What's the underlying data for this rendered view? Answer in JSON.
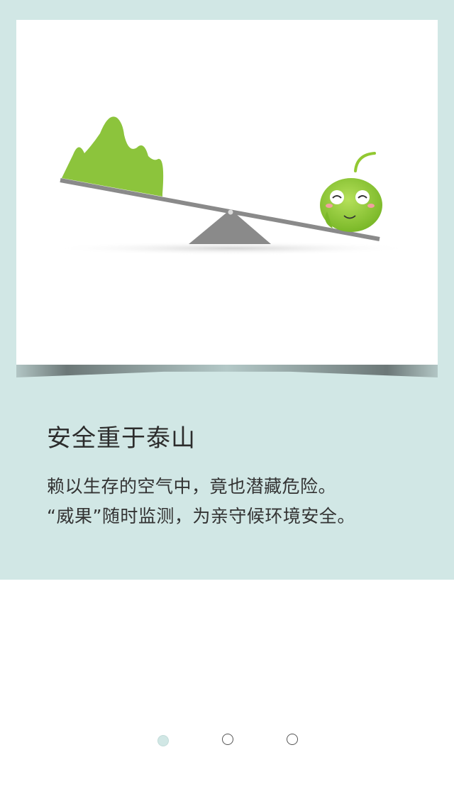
{
  "intro": {
    "headline": "安全重于泰山",
    "description_line1": "赖以生存的空气中，竟也潜藏危险。",
    "description_line2": "“威果”随时监测，为亲守候环境安全。"
  },
  "illustration": {
    "mountain_color": "#8cc43c",
    "mascot_color": "#92c832",
    "seesaw_color": "#8a8a8a"
  },
  "pagination": {
    "total_pages": 3,
    "current_page": 1,
    "active_color": "#d1e7e5"
  }
}
